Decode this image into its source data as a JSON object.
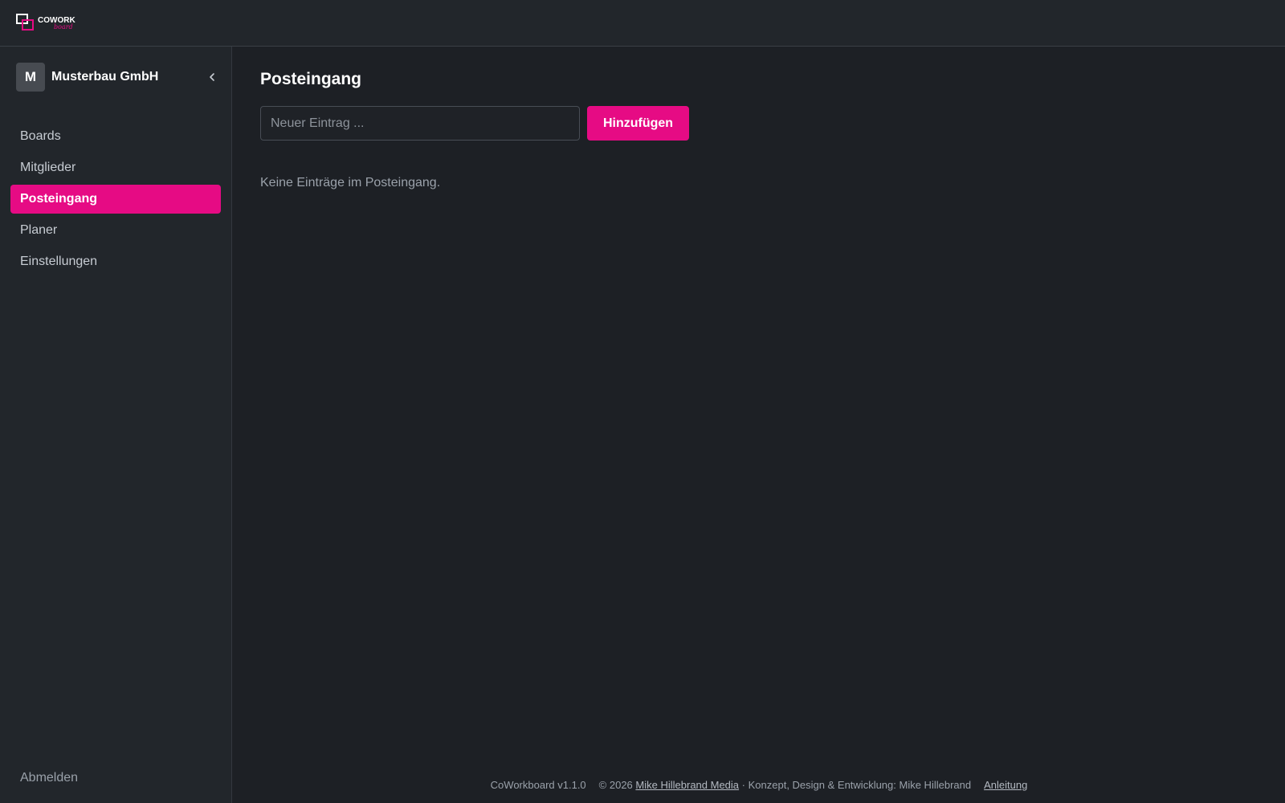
{
  "header": {
    "logo": {
      "text_main": "COWORK",
      "text_accent": "board",
      "accent_color": "#e60b84"
    }
  },
  "sidebar": {
    "org_initial": "M",
    "org_name": "Musterbau GmbH",
    "collapse_icon": "chevron-left-icon",
    "items": [
      {
        "label": "Boards",
        "active": false
      },
      {
        "label": "Mitglieder",
        "active": false
      },
      {
        "label": "Posteingang",
        "active": true
      },
      {
        "label": "Planer",
        "active": false
      },
      {
        "label": "Einstellungen",
        "active": false
      }
    ],
    "logout_label": "Abmelden"
  },
  "main": {
    "title": "Posteingang",
    "input_placeholder": "Neuer Eintrag ...",
    "input_value": "",
    "add_button_label": "Hinzufügen",
    "empty_message": "Keine Einträge im Posteingang."
  },
  "footer": {
    "version": "CoWorkboard v1.1.0",
    "copyright_prefix": "© 2026",
    "company_link": "Mike Hillebrand Media",
    "credits": "· Konzept, Design & Entwicklung: Mike Hillebrand",
    "guide_link": "Anleitung"
  },
  "colors": {
    "accent": "#e60b84",
    "background": "#1d2025",
    "sidebar": "#22262b"
  }
}
